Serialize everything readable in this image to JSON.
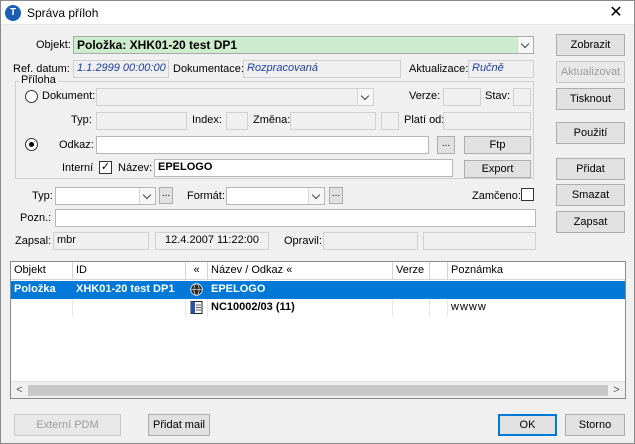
{
  "window": {
    "title": "Správa příloh",
    "icon": "app-logo-icon",
    "close_glyph": "✕"
  },
  "objekt": {
    "label": "Objekt:",
    "value": "Položka: XHK01-20 test DP1"
  },
  "ref": {
    "ref_label": "Ref. datum:",
    "ref_value": "1.1.2999 00:00:00",
    "doc_label": "Dokumentace:",
    "doc_value": "Rozpracovaná",
    "akt_label": "Aktualizace:",
    "akt_value": "Ručně"
  },
  "priloha": {
    "group_label": "Příloha",
    "dokument_label": "Dokument:",
    "verze_label": "Verze:",
    "stav_label": "Stav:",
    "typ_label": "Typ:",
    "index_label": "Index:",
    "zmena_label": "Změna:",
    "platiod_label": "Platí od:",
    "odkaz_label": "Odkaz:",
    "odkaz_value": "",
    "ellipsis": "...",
    "interni_label": "Interní",
    "interni_check": "✓",
    "nazev_label": "Název:",
    "nazev_value": "EPELOGO",
    "ftp_label": "Ftp",
    "export_label": "Export"
  },
  "extra": {
    "typ_label": "Typ:",
    "format_label": "Formát:",
    "zamceno_label": "Zamčeno:",
    "pozn_label": "Pozn.:",
    "zapsal_label": "Zapsal:",
    "zapsal_value": "mbr",
    "zapsal_date": "12.4.2007 11:22:00",
    "opravil_label": "Opravil:"
  },
  "side_buttons": {
    "zobrazit": "Zobrazit",
    "aktualizovat": "Aktualizovat",
    "tisknout": "Tisknout",
    "pouziti": "Použití",
    "pridat": "Přidat",
    "smazat": "Smazat",
    "zapsat": "Zapsat"
  },
  "table": {
    "columns": [
      "Objekt",
      "ID",
      "«",
      "Název / Odkaz «",
      "Verze",
      "",
      "Poznámka"
    ],
    "rows": [
      {
        "objekt": "Položka",
        "id": "XHK01-20 test DP1",
        "icon": "globe-icon",
        "nazev": "EPELOGO",
        "verze": "",
        "poznamka": "",
        "selected": true
      },
      {
        "objekt": "",
        "id": "",
        "icon": "document-icon",
        "nazev": "NC10002/03 (11)",
        "verze": "",
        "poznamka": "wwww",
        "selected": false
      }
    ],
    "scroll_left": "<",
    "scroll_right": ">"
  },
  "bottom": {
    "externi_pdm": "Externí PDM",
    "pridat_mail": "Přidat mail",
    "ok": "OK",
    "storno": "Storno"
  },
  "colors": {
    "accent": "#0078d7",
    "objekt_bg": "#cdeccd",
    "readonly_text": "#1c3fa0"
  }
}
